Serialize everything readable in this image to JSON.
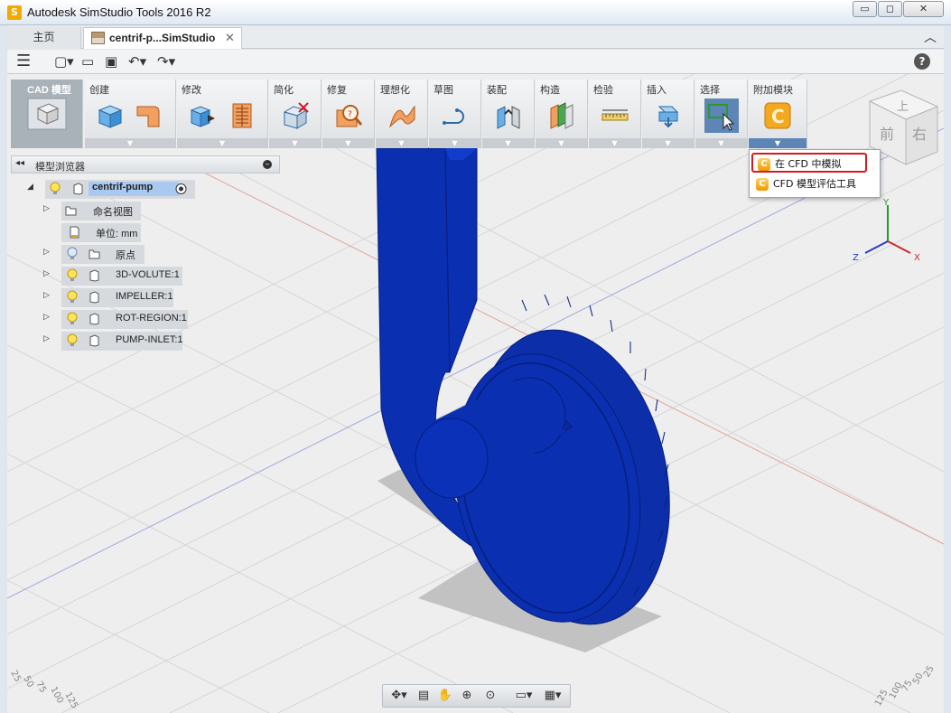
{
  "window": {
    "title": "Autodesk SimStudio Tools 2016 R2",
    "buttons": {
      "minimize": "▭",
      "maximize": "◻",
      "close": "✕"
    }
  },
  "tabs": {
    "home": "主页",
    "document": "centrif-p...SimStudio",
    "close_glyph": "✕",
    "collapse_glyph": "︿"
  },
  "quick_access": {
    "menu_glyph": "☰",
    "new_glyph": "▢▾",
    "open_glyph": "▭",
    "save_glyph": "▣",
    "undo_glyph": "↶▾",
    "redo_glyph": "↷▾",
    "help_glyph": "?"
  },
  "ribbon": {
    "groups": [
      {
        "id": "cad",
        "label": "CAD 模型"
      },
      {
        "id": "create",
        "label": "创建"
      },
      {
        "id": "modify",
        "label": "修改"
      },
      {
        "id": "simplify",
        "label": "简化"
      },
      {
        "id": "repair",
        "label": "修复"
      },
      {
        "id": "idealize",
        "label": "理想化"
      },
      {
        "id": "sketch",
        "label": "草图"
      },
      {
        "id": "assemble",
        "label": "装配"
      },
      {
        "id": "construct",
        "label": "构造"
      },
      {
        "id": "inspect",
        "label": "检验"
      },
      {
        "id": "insert",
        "label": "插入"
      },
      {
        "id": "select",
        "label": "选择"
      },
      {
        "id": "addins",
        "label": "附加模块"
      }
    ],
    "foot_glyph": "▼"
  },
  "addin_menu": {
    "items": [
      {
        "label": "在 CFD 中模拟",
        "icon": "C"
      },
      {
        "label": "CFD 模型评估工具",
        "icon": "C"
      }
    ]
  },
  "browser": {
    "collapse_glyph": "◂◂",
    "title": "模型浏览器",
    "minus_glyph": "–",
    "root": "centrif-pump",
    "nodes": [
      {
        "label": "命名视图"
      },
      {
        "label": "单位: mm"
      },
      {
        "label": "原点"
      },
      {
        "label": "3D-VOLUTE:1"
      },
      {
        "label": "IMPELLER:1"
      },
      {
        "label": "ROT-REGION:1"
      },
      {
        "label": "PUMP-INLET:1"
      }
    ],
    "toggle_open": "◢",
    "toggle_closed": "▷"
  },
  "axes": {
    "x": "X",
    "y": "Y",
    "z": "Z"
  },
  "viewcube": {
    "top": "上",
    "front": "前",
    "right": "右"
  },
  "grid_ticks": {
    "left": [
      "25",
      "50",
      "75",
      "100",
      "125"
    ],
    "right": [
      "25",
      "50",
      "75",
      "100",
      "125"
    ]
  },
  "navbar": {
    "orbit": "✥▾",
    "look": "▤",
    "pan": "✋",
    "zoom": "⊕",
    "fit": "⊙",
    "display": "▭▾",
    "grid": "▦▾"
  },
  "colors": {
    "model_blue": "#0a2fb0",
    "model_dark": "#061e7a",
    "highlight_red": "#d7191c",
    "addin_orange": "#f09a00"
  }
}
